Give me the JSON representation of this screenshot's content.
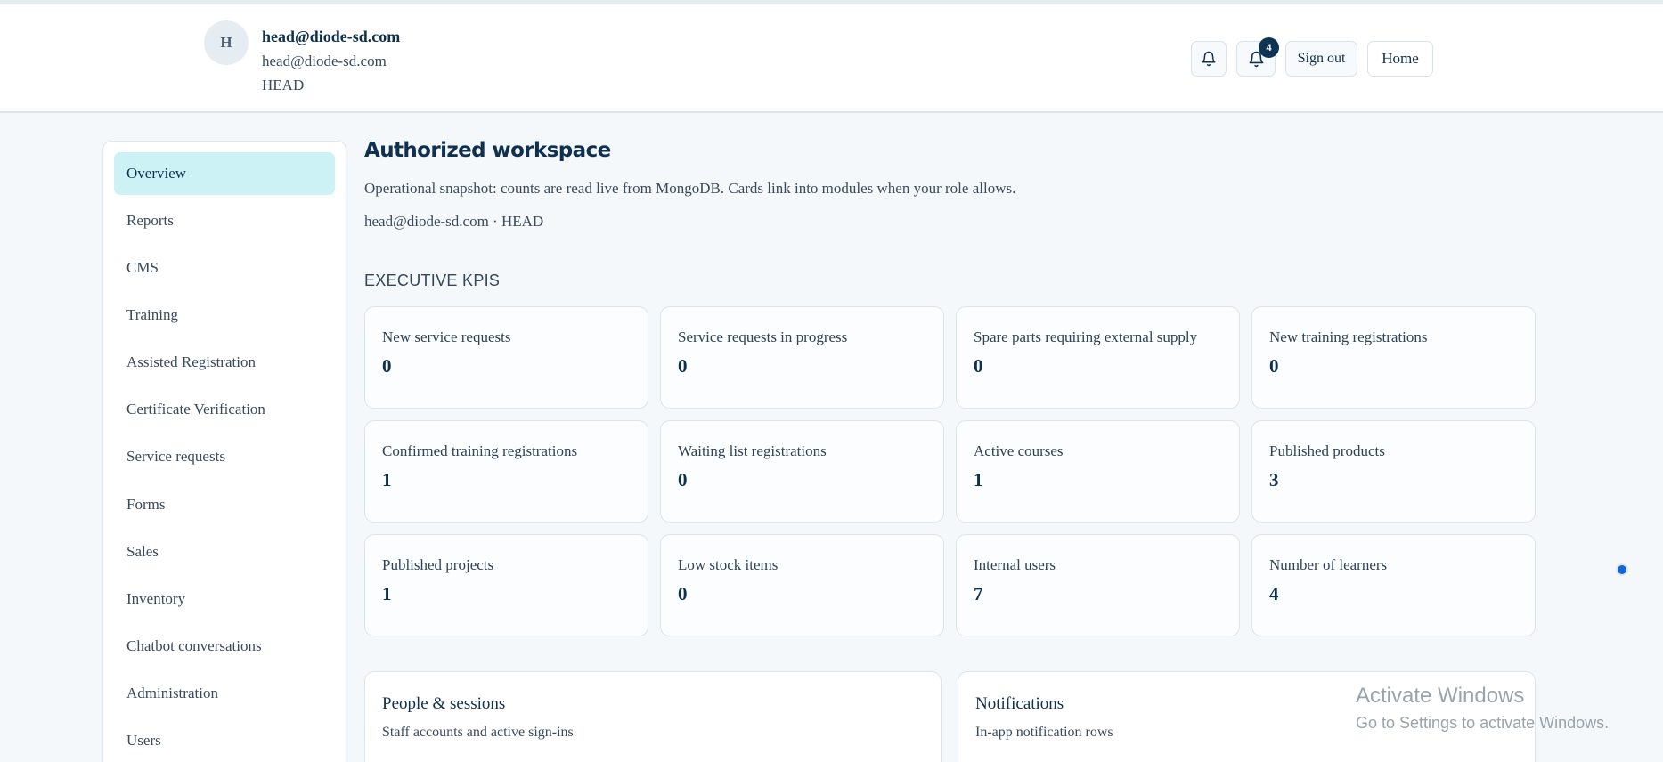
{
  "header": {
    "avatar_initial": "H",
    "user_name": "head@diode-sd.com",
    "user_email": "head@diode-sd.com",
    "user_role": "HEAD",
    "notification_count": "4",
    "signout_label": "Sign out",
    "home_label": "Home"
  },
  "sidebar": {
    "items": [
      {
        "label": "Overview",
        "active": true
      },
      {
        "label": "Reports"
      },
      {
        "label": "CMS"
      },
      {
        "label": "Training"
      },
      {
        "label": "Assisted Registration"
      },
      {
        "label": "Certificate Verification"
      },
      {
        "label": "Service requests"
      },
      {
        "label": "Forms"
      },
      {
        "label": "Sales"
      },
      {
        "label": "Inventory"
      },
      {
        "label": "Chatbot conversations"
      },
      {
        "label": "Administration"
      },
      {
        "label": "Users"
      }
    ]
  },
  "main": {
    "title": "Authorized workspace",
    "description": "Operational snapshot: counts are read live from MongoDB. Cards link into modules when your role allows.",
    "user_line": "head@diode-sd.com · HEAD",
    "kpi_heading": "EXECUTIVE KPIS",
    "kpis": [
      {
        "label": "New service requests",
        "value": "0"
      },
      {
        "label": "Service requests in progress",
        "value": "0"
      },
      {
        "label": "Spare parts requiring external supply",
        "value": "0"
      },
      {
        "label": "New training registrations",
        "value": "0"
      },
      {
        "label": "Confirmed training registrations",
        "value": "1"
      },
      {
        "label": "Waiting list registrations",
        "value": "0"
      },
      {
        "label": "Active courses",
        "value": "1"
      },
      {
        "label": "Published products",
        "value": "3"
      },
      {
        "label": "Published projects",
        "value": "1"
      },
      {
        "label": "Low stock items",
        "value": "0"
      },
      {
        "label": "Internal users",
        "value": "7"
      },
      {
        "label": "Number of learners",
        "value": "4"
      }
    ],
    "panels": [
      {
        "title": "People & sessions",
        "subtitle": "Staff accounts and active sign-ins"
      },
      {
        "title": "Notifications",
        "subtitle": "In-app notification rows"
      }
    ]
  },
  "watermark": {
    "line1": "Activate Windows",
    "line2": "Go to Settings to activate Windows."
  },
  "colors": {
    "accent_active": "#cdf2f6",
    "primary_text": "#10304f",
    "badge": "#0f3352",
    "page_bg": "#f4f8fa"
  },
  "icons": [
    "bell-icon",
    "notification-bell-icon"
  ]
}
